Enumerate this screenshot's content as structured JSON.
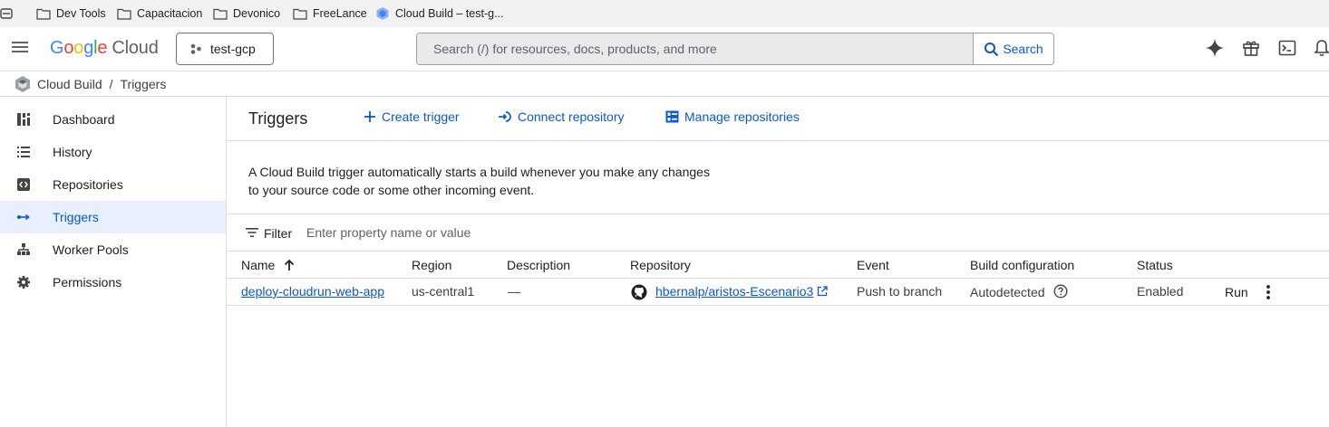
{
  "bookmarks": [
    {
      "label": "Dev Tools",
      "icon": "folder-icon"
    },
    {
      "label": "Capacitacion",
      "icon": "folder-icon"
    },
    {
      "label": "Devonico",
      "icon": "folder-icon"
    },
    {
      "label": "FreeLance",
      "icon": "folder-icon"
    },
    {
      "label": "Cloud Build – test-g...",
      "icon": "cloud-build-icon"
    }
  ],
  "header": {
    "logo_google": "Google",
    "logo_cloud": "Cloud",
    "project": "test-gcp",
    "search_placeholder": "Search (/) for resources, docs, products, and more",
    "search_button": "Search"
  },
  "breadcrumb": {
    "product": "Cloud Build",
    "separator": "/",
    "page": "Triggers"
  },
  "sidebar": {
    "items": [
      {
        "label": "Dashboard",
        "icon": "dashboard-icon"
      },
      {
        "label": "History",
        "icon": "history-list-icon"
      },
      {
        "label": "Repositories",
        "icon": "repository-icon"
      },
      {
        "label": "Triggers",
        "icon": "trigger-arrow-icon",
        "active": true
      },
      {
        "label": "Worker Pools",
        "icon": "worker-pools-icon"
      },
      {
        "label": "Permissions",
        "icon": "gear-icon"
      }
    ]
  },
  "toolbar": {
    "title": "Triggers",
    "create_trigger": "Create trigger",
    "connect_repository": "Connect repository",
    "manage_repositories": "Manage repositories"
  },
  "description": {
    "line1": "A Cloud Build trigger automatically starts a build whenever you make any changes",
    "line2": "to your source code or some other incoming event."
  },
  "filter": {
    "label": "Filter",
    "placeholder": "Enter property name or value"
  },
  "table": {
    "columns": [
      "Name",
      "Region",
      "Description",
      "Repository",
      "Event",
      "Build configuration",
      "Status"
    ],
    "rows": [
      {
        "name": "deploy-cloudrun-web-app",
        "region": "us-central1",
        "description": "—",
        "repository": "hbernalp/aristos-Escenario3",
        "event": "Push to branch",
        "build_configuration": "Autodetected",
        "status": "Enabled",
        "action": "Run"
      }
    ]
  },
  "colors": {
    "accent": "#0b57d0",
    "active_bg": "#e8f0fe",
    "border": "#dadce0"
  }
}
